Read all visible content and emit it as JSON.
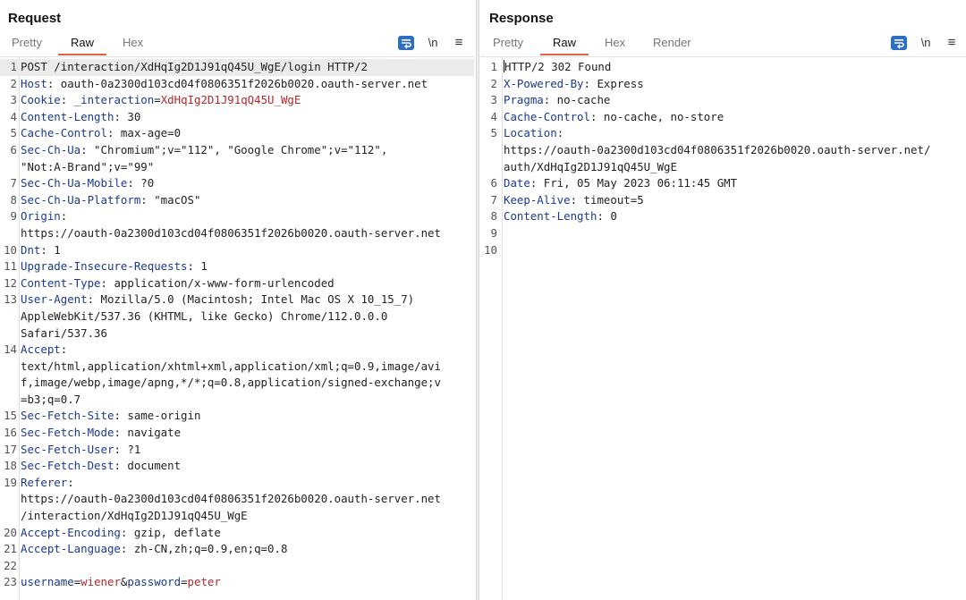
{
  "layout_switch": {
    "options": [
      "split-horizontal-icon",
      "split-vertical-icon",
      "single-pane-icon"
    ],
    "selected": 0,
    "accent": "#2d6fc4"
  },
  "request": {
    "title": "Request",
    "tabs": [
      {
        "label": "Pretty",
        "active": false
      },
      {
        "label": "Raw",
        "active": true
      },
      {
        "label": "Hex",
        "active": false
      }
    ],
    "tools": {
      "newline_label": "\\n",
      "menu_label": "≡"
    },
    "lines": [
      {
        "n": "1",
        "parts": [
          {
            "t": "POST /interaction/XdHqIg2D1J91qQ45U_WgE/login HTTP/2",
            "c": "v"
          }
        ]
      },
      {
        "n": "2",
        "parts": [
          {
            "t": "Host",
            "c": "k"
          },
          {
            "t": ": oauth-0a2300d103cd04f0806351f2026b0020.oauth-server.net",
            "c": "v"
          }
        ]
      },
      {
        "n": "3",
        "parts": [
          {
            "t": "Cookie",
            "c": "k"
          },
          {
            "t": ": ",
            "c": "v"
          },
          {
            "t": "_interaction",
            "c": "ck"
          },
          {
            "t": "=",
            "c": "v"
          },
          {
            "t": "XdHqIg2D1J91qQ45U_WgE",
            "c": "cv"
          }
        ]
      },
      {
        "n": "4",
        "parts": [
          {
            "t": "Content-Length",
            "c": "k"
          },
          {
            "t": ": 30",
            "c": "v"
          }
        ]
      },
      {
        "n": "5",
        "parts": [
          {
            "t": "Cache-Control",
            "c": "k"
          },
          {
            "t": ": max-age=0",
            "c": "v"
          }
        ]
      },
      {
        "n": "6",
        "parts": [
          {
            "t": "Sec-Ch-Ua",
            "c": "k"
          },
          {
            "t": ": \"Chromium\";v=\"112\", \"Google Chrome\";v=\"112\",",
            "c": "v"
          }
        ]
      },
      {
        "n": "",
        "parts": [
          {
            "t": "\"Not:A-Brand\";v=\"99\"",
            "c": "v"
          }
        ]
      },
      {
        "n": "7",
        "parts": [
          {
            "t": "Sec-Ch-Ua-Mobile",
            "c": "k"
          },
          {
            "t": ": ?0",
            "c": "v"
          }
        ]
      },
      {
        "n": "8",
        "parts": [
          {
            "t": "Sec-Ch-Ua-Platform",
            "c": "k"
          },
          {
            "t": ": \"macOS\"",
            "c": "v"
          }
        ]
      },
      {
        "n": "9",
        "parts": [
          {
            "t": "Origin",
            "c": "k"
          },
          {
            "t": ":",
            "c": "v"
          }
        ]
      },
      {
        "n": "",
        "parts": [
          {
            "t": "https://oauth-0a2300d103cd04f0806351f2026b0020.oauth-server.net",
            "c": "v"
          }
        ]
      },
      {
        "n": "10",
        "parts": [
          {
            "t": "Dnt",
            "c": "k"
          },
          {
            "t": ": 1",
            "c": "v"
          }
        ]
      },
      {
        "n": "11",
        "parts": [
          {
            "t": "Upgrade-Insecure-Requests",
            "c": "k"
          },
          {
            "t": ": 1",
            "c": "v"
          }
        ]
      },
      {
        "n": "12",
        "parts": [
          {
            "t": "Content-Type",
            "c": "k"
          },
          {
            "t": ": application/x-www-form-urlencoded",
            "c": "v"
          }
        ]
      },
      {
        "n": "13",
        "parts": [
          {
            "t": "User-Agent",
            "c": "k"
          },
          {
            "t": ": Mozilla/5.0 (Macintosh; Intel Mac OS X 10_15_7)",
            "c": "v"
          }
        ]
      },
      {
        "n": "",
        "parts": [
          {
            "t": "AppleWebKit/537.36 (KHTML, like Gecko) Chrome/112.0.0.0",
            "c": "v"
          }
        ]
      },
      {
        "n": "",
        "parts": [
          {
            "t": "Safari/537.36",
            "c": "v"
          }
        ]
      },
      {
        "n": "14",
        "parts": [
          {
            "t": "Accept",
            "c": "k"
          },
          {
            "t": ":",
            "c": "v"
          }
        ]
      },
      {
        "n": "",
        "parts": [
          {
            "t": "text/html,application/xhtml+xml,application/xml;q=0.9,image/avi",
            "c": "v"
          }
        ]
      },
      {
        "n": "",
        "parts": [
          {
            "t": "f,image/webp,image/apng,*/*;q=0.8,application/signed-exchange;v",
            "c": "v"
          }
        ]
      },
      {
        "n": "",
        "parts": [
          {
            "t": "=b3;q=0.7",
            "c": "v"
          }
        ]
      },
      {
        "n": "15",
        "parts": [
          {
            "t": "Sec-Fetch-Site",
            "c": "k"
          },
          {
            "t": ": same-origin",
            "c": "v"
          }
        ]
      },
      {
        "n": "16",
        "parts": [
          {
            "t": "Sec-Fetch-Mode",
            "c": "k"
          },
          {
            "t": ": navigate",
            "c": "v"
          }
        ]
      },
      {
        "n": "17",
        "parts": [
          {
            "t": "Sec-Fetch-User",
            "c": "k"
          },
          {
            "t": ": ?1",
            "c": "v"
          }
        ]
      },
      {
        "n": "18",
        "parts": [
          {
            "t": "Sec-Fetch-Dest",
            "c": "k"
          },
          {
            "t": ": document",
            "c": "v"
          }
        ]
      },
      {
        "n": "19",
        "parts": [
          {
            "t": "Referer",
            "c": "k"
          },
          {
            "t": ":",
            "c": "v"
          }
        ]
      },
      {
        "n": "",
        "parts": [
          {
            "t": "https://oauth-0a2300d103cd04f0806351f2026b0020.oauth-server.net",
            "c": "v"
          }
        ]
      },
      {
        "n": "",
        "parts": [
          {
            "t": "/interaction/XdHqIg2D1J91qQ45U_WgE",
            "c": "v"
          }
        ]
      },
      {
        "n": "20",
        "parts": [
          {
            "t": "Accept-Encoding",
            "c": "k"
          },
          {
            "t": ": gzip, deflate",
            "c": "v"
          }
        ]
      },
      {
        "n": "21",
        "parts": [
          {
            "t": "Accept-Language",
            "c": "k"
          },
          {
            "t": ": zh-CN,zh;q=0.9,en;q=0.8",
            "c": "v"
          }
        ]
      },
      {
        "n": "22",
        "parts": []
      },
      {
        "n": "23",
        "parts": [
          {
            "t": "username",
            "c": "pk"
          },
          {
            "t": "=",
            "c": "ps"
          },
          {
            "t": "wiener",
            "c": "pv"
          },
          {
            "t": "&",
            "c": "ps"
          },
          {
            "t": "password",
            "c": "pk"
          },
          {
            "t": "=",
            "c": "ps"
          },
          {
            "t": "peter",
            "c": "pv"
          }
        ]
      }
    ]
  },
  "response": {
    "title": "Response",
    "tabs": [
      {
        "label": "Pretty",
        "active": false
      },
      {
        "label": "Raw",
        "active": true
      },
      {
        "label": "Hex",
        "active": false
      },
      {
        "label": "Render",
        "active": false
      }
    ],
    "tools": {
      "newline_label": "\\n",
      "menu_label": "≡"
    },
    "lines": [
      {
        "n": "1",
        "cursor": true,
        "parts": [
          {
            "t": "HTTP/2 302 Found",
            "c": "v"
          }
        ]
      },
      {
        "n": "2",
        "parts": [
          {
            "t": "X-Powered-By",
            "c": "k"
          },
          {
            "t": ": Express",
            "c": "v"
          }
        ]
      },
      {
        "n": "3",
        "parts": [
          {
            "t": "Pragma",
            "c": "k"
          },
          {
            "t": ": no-cache",
            "c": "v"
          }
        ]
      },
      {
        "n": "4",
        "parts": [
          {
            "t": "Cache-Control",
            "c": "k"
          },
          {
            "t": ": no-cache, no-store",
            "c": "v"
          }
        ]
      },
      {
        "n": "5",
        "parts": [
          {
            "t": "Location",
            "c": "k"
          },
          {
            "t": ":",
            "c": "v"
          }
        ]
      },
      {
        "n": "",
        "parts": [
          {
            "t": "https://oauth-0a2300d103cd04f0806351f2026b0020.oauth-server.net/",
            "c": "v"
          }
        ]
      },
      {
        "n": "",
        "parts": [
          {
            "t": "auth/XdHqIg2D1J91qQ45U_WgE",
            "c": "v"
          }
        ]
      },
      {
        "n": "6",
        "parts": [
          {
            "t": "Date",
            "c": "k"
          },
          {
            "t": ": Fri, 05 May 2023 06:11:45 GMT",
            "c": "v"
          }
        ]
      },
      {
        "n": "7",
        "parts": [
          {
            "t": "Keep-Alive",
            "c": "k"
          },
          {
            "t": ": timeout=5",
            "c": "v"
          }
        ]
      },
      {
        "n": "8",
        "parts": [
          {
            "t": "Content-Length",
            "c": "k"
          },
          {
            "t": ": 0",
            "c": "v"
          }
        ]
      },
      {
        "n": "9",
        "parts": []
      },
      {
        "n": "10",
        "parts": []
      }
    ]
  }
}
